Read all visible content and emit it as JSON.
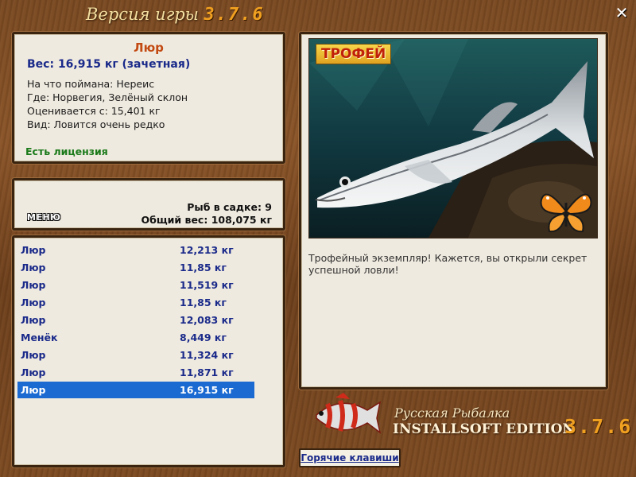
{
  "title": {
    "text": "Версия игры",
    "version": "3.7.6"
  },
  "window": {
    "close_icon": "close-icon"
  },
  "fish_info": {
    "name": "Люр",
    "weight": "Вес: 16,915 кг (зачетная)",
    "caught_on": "На что поймана: Нереис",
    "location": "Где: Норвегия, Зелёный склон",
    "value": "Оценивается с: 15,401 кг",
    "rarity": "Вид: Ловится очень редко",
    "license": "Есть лицензия"
  },
  "summary": {
    "menu_label": "МЕНЮ",
    "count": "Рыб в садке: 9",
    "total_weight": "Общий вес: 108,075 кг"
  },
  "catch_list": [
    {
      "name": "Люр",
      "weight": "12,213 кг"
    },
    {
      "name": "Люр",
      "weight": "11,85 кг"
    },
    {
      "name": "Люр",
      "weight": "11,519 кг"
    },
    {
      "name": "Люр",
      "weight": "11,85 кг"
    },
    {
      "name": "Люр",
      "weight": "12,083 кг"
    },
    {
      "name": "Менёк",
      "weight": "8,449 кг"
    },
    {
      "name": "Люр",
      "weight": "11,324 кг"
    },
    {
      "name": "Люр",
      "weight": "11,871 кг"
    },
    {
      "name": "Люр",
      "weight": "16,915 кг"
    }
  ],
  "selected_index": 8,
  "details": {
    "badge": "ТРОФЕЙ",
    "text": "Трофейный экземпляр! Кажется, вы открыли секрет успешной ловли!"
  },
  "branding": {
    "line1": "Русская Рыбалка",
    "line2": "INSTALLSOFT EDITION",
    "version": "3.7.6"
  },
  "hotkeys_label": "Горячие клавиши",
  "colors": {
    "selection": "#1a6ad2",
    "accent": "#f0a020",
    "name": "#c24a12",
    "link": "#1a2a8a"
  }
}
